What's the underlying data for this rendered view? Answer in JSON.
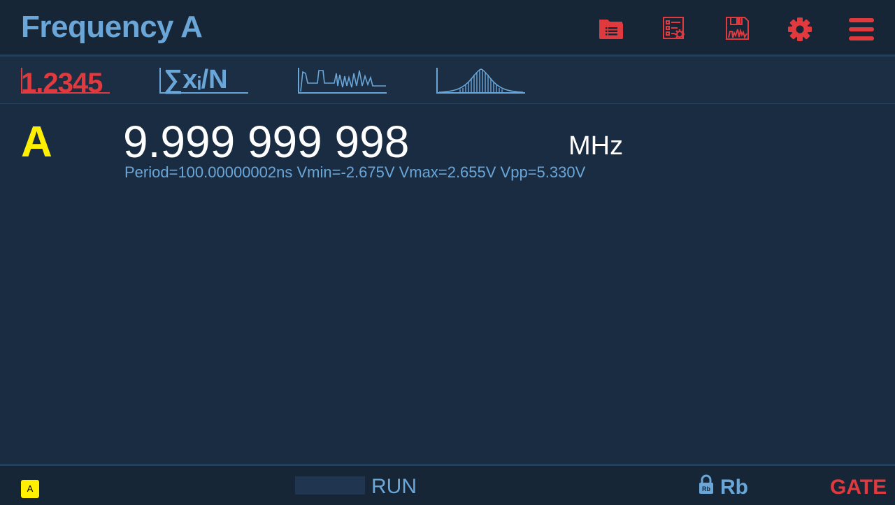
{
  "header": {
    "title": "Frequency A",
    "icons": [
      "folder-list-icon",
      "settings-checklist-icon",
      "save-waveform-icon",
      "gear-icon",
      "menu-icon"
    ]
  },
  "tabs": [
    {
      "name": "numeric-view",
      "label": "1.2345"
    },
    {
      "name": "statistics-view",
      "label": "∑xᵢ/N"
    },
    {
      "name": "trend-view",
      "icon": "trend-chart-icon"
    },
    {
      "name": "histogram-view",
      "icon": "histogram-chart-icon"
    }
  ],
  "measurement": {
    "channel": "A",
    "value": "9.999 999 998",
    "unit": "MHz",
    "aux": "Period=100.00000002ns Vmin=-2.675V Vmax=2.655V Vpp=5.330V"
  },
  "status": {
    "channel_badge": "A",
    "run_label": "RUN",
    "reference_label": "Rb",
    "lock_icon_text": "Rb",
    "gate_label": "GATE"
  },
  "colors": {
    "background": "#1a2c42",
    "accent_blue": "#6aa6d8",
    "accent_red": "#e0393e",
    "channel_yellow": "#ffef00"
  }
}
